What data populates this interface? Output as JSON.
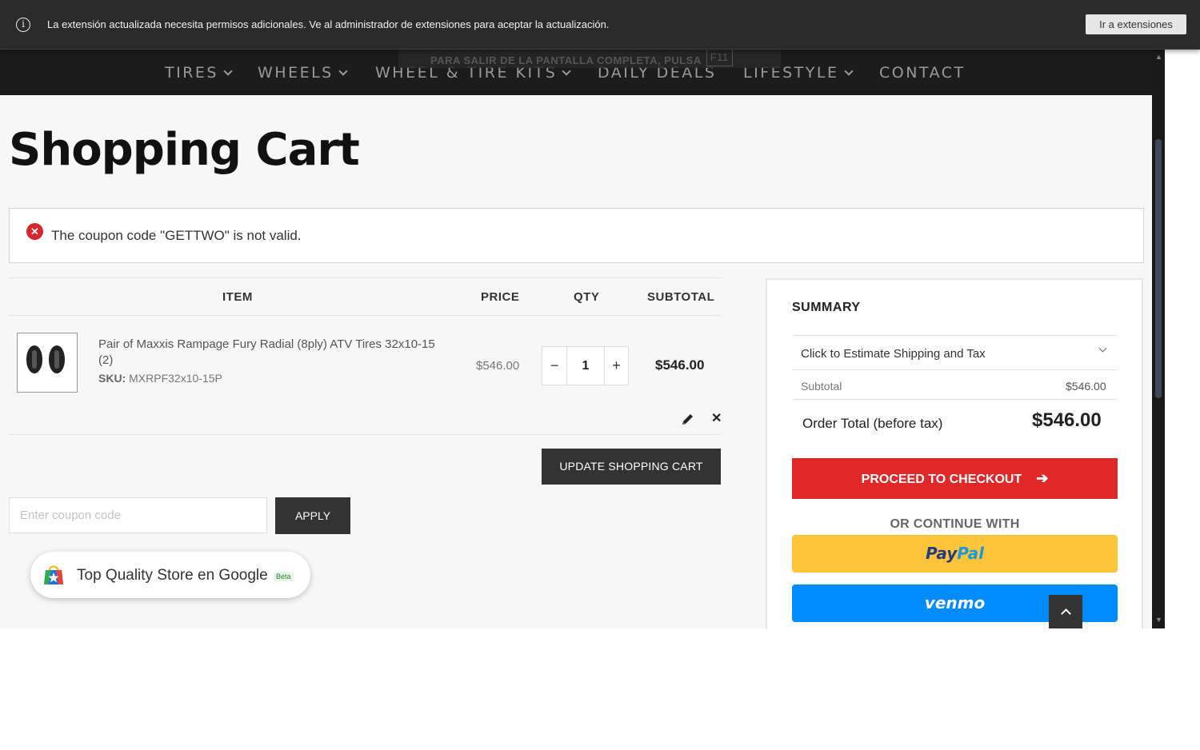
{
  "notification": {
    "text": "La extensión actualizada necesita permisos adicionales. Ve al administrador de extensiones para aceptar la actualización.",
    "button": "Ir a extensiones"
  },
  "fullscreen_hint": {
    "text": "PARA SALIR DE LA PANTALLA COMPLETA, PULSA",
    "key": "F11"
  },
  "nav": {
    "items": [
      {
        "label": "TIRES",
        "has_dropdown": true
      },
      {
        "label": "WHEELS",
        "has_dropdown": true
      },
      {
        "label": "WHEEL & TIRE KITS",
        "has_dropdown": true
      },
      {
        "label": "DAILY DEALS",
        "has_dropdown": false
      },
      {
        "label": "LIFESTYLE",
        "has_dropdown": true
      },
      {
        "label": "CONTACT",
        "has_dropdown": false
      }
    ]
  },
  "page": {
    "title": "Shopping Cart"
  },
  "error": {
    "message": "The coupon code \"GETTWO\" is not valid."
  },
  "cart": {
    "headers": {
      "item": "ITEM",
      "price": "PRICE",
      "qty": "QTY",
      "subtotal": "SUBTOTAL"
    },
    "items": [
      {
        "name": "Pair of Maxxis Rampage Fury Radial (8ply) ATV Tires 32x10-15 (2)",
        "sku_label": "SKU:",
        "sku": "MXRPF32x10-15P",
        "price": "$546.00",
        "qty": "1",
        "subtotal": "$546.00"
      }
    ],
    "qty_minus": "−",
    "qty_plus": "+",
    "update_button": "UPDATE SHOPPING CART"
  },
  "coupon": {
    "placeholder": "Enter coupon code",
    "value": "",
    "apply_button": "APPLY"
  },
  "google_badge": {
    "text": "Top Quality Store en Google",
    "beta": "Beta"
  },
  "summary": {
    "title": "SUMMARY",
    "shipping_estimate": "Click to Estimate Shipping and Tax",
    "subtotal_label": "Subtotal",
    "subtotal_value": "$546.00",
    "total_label": "Order Total (before tax)",
    "total_value": "$546.00",
    "checkout_button": "PROCEED TO CHECKOUT",
    "or_continue": "OR CONTINUE WITH",
    "paypal": {
      "pay": "Pay",
      "pal": "Pal"
    },
    "venmo": "venmo"
  },
  "colors": {
    "accent_red": "#e02828",
    "paypal_yellow": "#ffc439",
    "venmo_blue": "#008cff",
    "nav_bg": "#1c1c1c",
    "button_dark": "#333333"
  }
}
